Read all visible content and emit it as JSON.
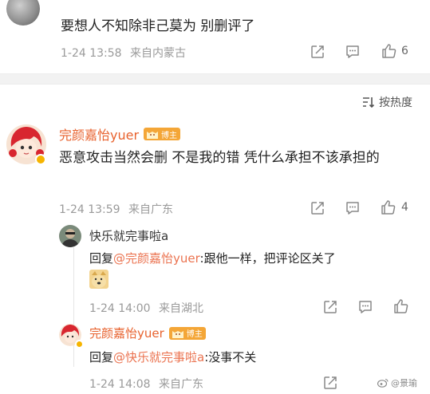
{
  "top_comment": {
    "text": "要想人不知除非己莫为 别删评了",
    "time": "1-24 13:58",
    "location": "来自内蒙古",
    "likes": "6"
  },
  "sort": {
    "label": "按热度",
    "icon": "sort-icon"
  },
  "main_comment": {
    "username": "完颜嘉怡yuer",
    "badge": "博主",
    "text": "恶意攻击当然会删 不是我的错 凭什么承担不该承担的",
    "time": "1-24 13:59",
    "location": "来自广东",
    "likes": "4"
  },
  "replies": [
    {
      "username": "快乐就完事啦a",
      "reply_prefix": "回复",
      "mention": "@完颜嘉怡yuer",
      "text": ":跟他一样，把评论区关了",
      "has_emoji": true,
      "time": "1-24 14:00",
      "location": "来自湖北"
    },
    {
      "username": "完颜嘉怡yuer",
      "badge": "博主",
      "reply_prefix": "回复",
      "mention": "@快乐就完事啦a",
      "text": ":没事不关",
      "time": "1-24 14:08",
      "location": "来自广东"
    }
  ],
  "watermark": "@景瑜"
}
